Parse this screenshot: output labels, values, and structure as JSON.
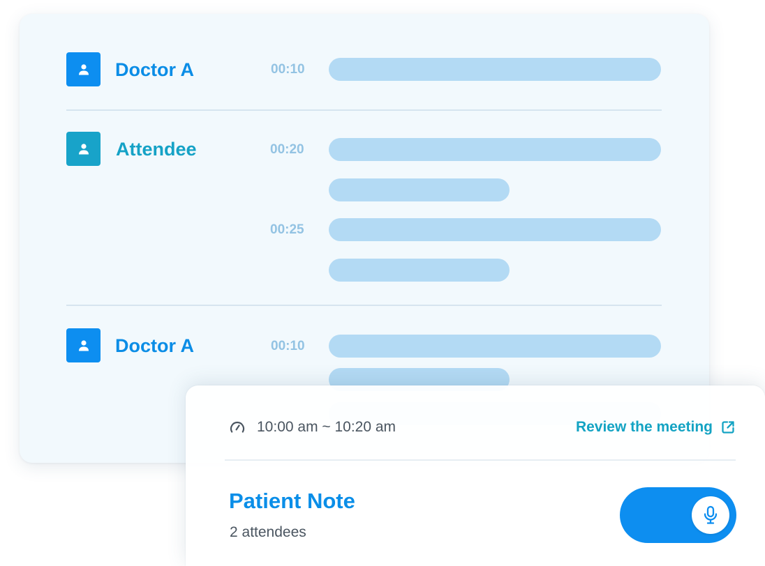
{
  "transcript": {
    "entries": [
      {
        "speaker": "Doctor A",
        "avatar_color": "#0d8ef0",
        "name_color": "#0b8de6",
        "lines": [
          {
            "time": "00:10"
          }
        ]
      },
      {
        "speaker": "Attendee",
        "avatar_color": "#18a3c9",
        "name_color": "#15a2c6",
        "lines": [
          {
            "time": "00:20"
          },
          {
            "time": "00:25"
          }
        ]
      },
      {
        "speaker": "Doctor A",
        "avatar_color": "#0d8ef0",
        "name_color": "#0b8de6",
        "lines": [
          {
            "time": "00:10"
          }
        ]
      }
    ],
    "placeholder_bar_color": "#b3daf4",
    "timestamp_color": "#93c3e3"
  },
  "meeting": {
    "time_range": "10:00 am ~ 10:20 am",
    "time_icon": "speedometer-icon",
    "review_link_label": "Review the meeting",
    "review_link_icon": "external-link-icon",
    "note_title": "Patient Note",
    "attendees_label": "2 attendees",
    "record_icon": "microphone-icon",
    "accent_color": "#0d8ef0",
    "link_color": "#14a3c3"
  }
}
